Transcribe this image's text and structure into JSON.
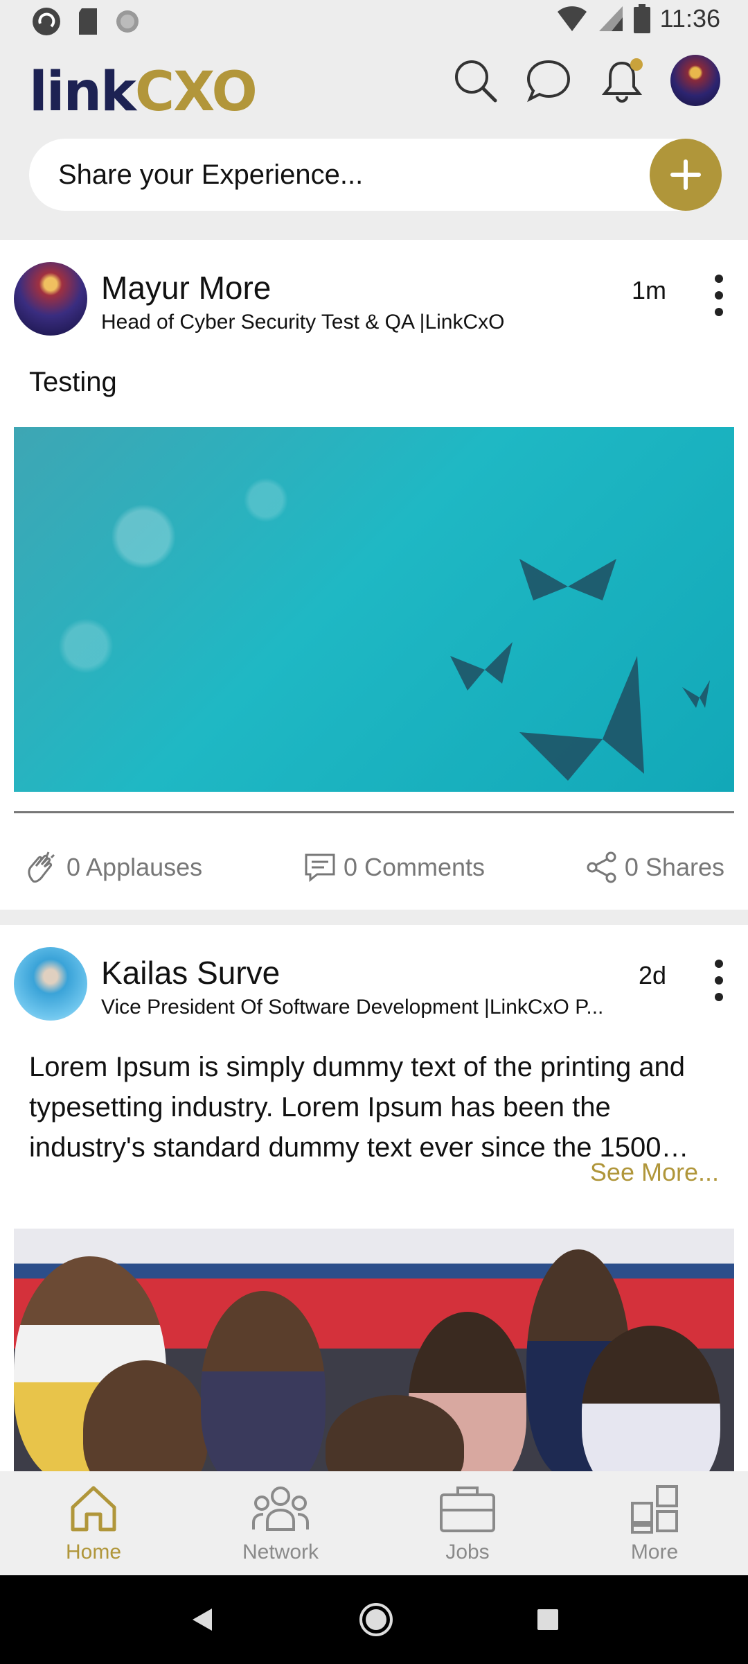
{
  "status_bar": {
    "time": "11:36"
  },
  "header": {
    "logo_link": "link",
    "logo_cxo": "CXO",
    "share_placeholder": "Share your Experience..."
  },
  "posts": [
    {
      "author": "Mayur More",
      "title": "Head of Cyber Security Test & QA |LinkCxO",
      "time": "1m",
      "body": "Testing",
      "applauses": "0 Applauses",
      "comments": "0 Comments",
      "shares": "0 Shares"
    },
    {
      "author": "Kailas Surve",
      "title": "Vice President Of Software Development |LinkCxO P...",
      "time": "2d",
      "body": "Lorem Ipsum is simply dummy text of the printing and typesetting industry. Lorem Ipsum has been the industry's standard dummy text ever since the 1500…",
      "see_more": "See More..."
    }
  ],
  "bottom_nav": [
    {
      "label": "Home",
      "icon": "home-icon",
      "active": true
    },
    {
      "label": "Network",
      "icon": "network-icon",
      "active": false
    },
    {
      "label": "Jobs",
      "icon": "briefcase-icon",
      "active": false
    },
    {
      "label": "More",
      "icon": "grid-icon",
      "active": false
    }
  ],
  "colors": {
    "accent": "#b0963a",
    "navy": "#1d2253",
    "background": "#ededed"
  }
}
